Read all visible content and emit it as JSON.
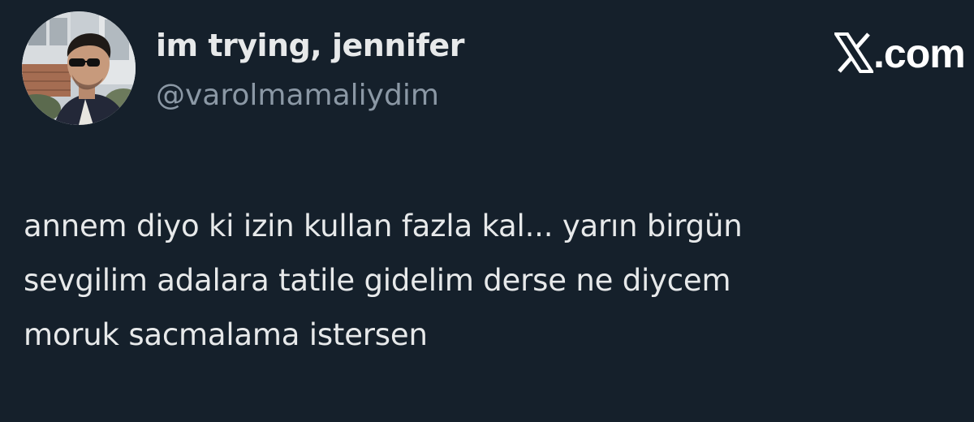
{
  "author": {
    "display_name": "im trying, jennifer",
    "handle": "@varolmamaliydim",
    "avatar_icon": "profile-photo"
  },
  "brand": {
    "icon": "x-logo-icon",
    "domain": ".com"
  },
  "tweet": {
    "text": "annem diyo ki izin kullan fazla kal... yarın birgün\nsevgilim adalara tatile gidelim derse ne diycem\nmoruk sacmalama istersen"
  },
  "colors": {
    "background": "#15202b",
    "text_primary": "#e7e9ea",
    "text_secondary": "#8b98a5",
    "brand": "#ffffff"
  }
}
